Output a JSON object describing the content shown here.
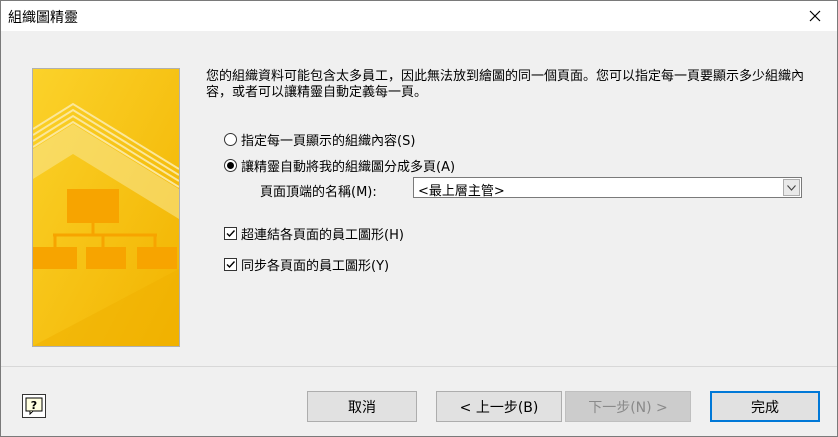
{
  "window": {
    "title": "組織圖精靈"
  },
  "description": "您的組織資料可能包含太多員工，因此無法放到繪圖的同一個頁面。您可以指定每一頁要顯示多少組織內容，或者可以讓精靈自動定義每一頁。",
  "options": {
    "radio1": {
      "label": "指定每一頁顯示的組織內容(S)",
      "selected": false
    },
    "radio2": {
      "label": "讓精靈自動將我的組織圖分成多頁(A)",
      "selected": true
    },
    "top_name_label": "頁面頂端的名稱(M):",
    "top_name_value": "<最上層主管>",
    "check1": {
      "label": "超連結各頁面的員工圖形(H)",
      "checked": true
    },
    "check2": {
      "label": "同步各頁面的員工圖形(Y)",
      "checked": true
    }
  },
  "buttons": {
    "cancel": "取消",
    "back": "< 上一步(B)",
    "next": "下一步(N) >",
    "finish": "完成"
  },
  "icons": {
    "close": "close-icon",
    "help": "help-icon",
    "dropdown": "chevron-down-icon"
  },
  "colors": {
    "accent": "#0078d7",
    "banner": "#f5c400"
  }
}
